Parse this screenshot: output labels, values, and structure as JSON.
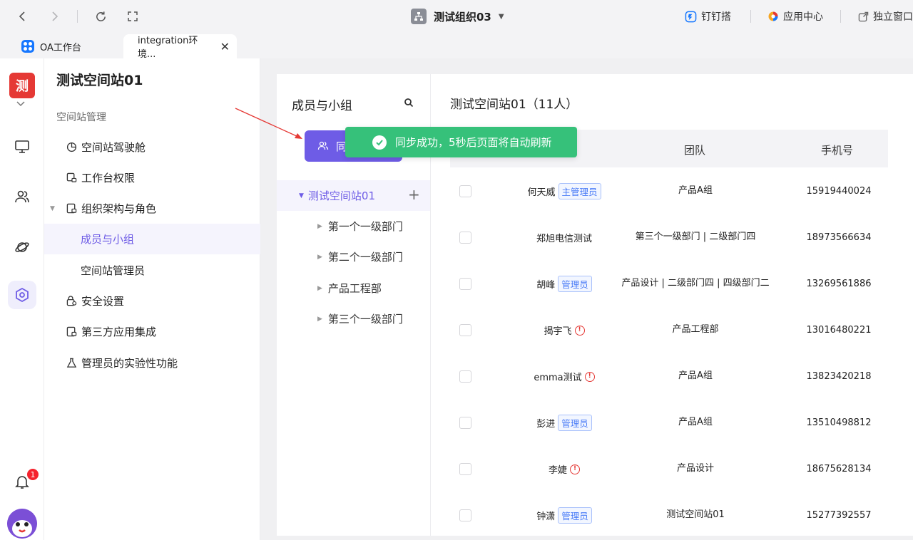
{
  "topbar": {
    "org_title": "测试组织03",
    "links": [
      "钉钉搭",
      "应用中心",
      "独立窗口"
    ]
  },
  "tabs": [
    {
      "label": "OA工作台"
    },
    {
      "label": "integration环境..."
    }
  ],
  "rail": {
    "logo_char": "测",
    "notification_count": "1"
  },
  "sidemenu": {
    "space_title": "测试空间站01",
    "section": "空间站管理",
    "items": [
      {
        "label": "空间站驾驶舱"
      },
      {
        "label": "工作台权限"
      },
      {
        "label": "组织架构与角色"
      },
      {
        "label": "成员与小组"
      },
      {
        "label": "空间站管理员"
      },
      {
        "label": "安全设置"
      },
      {
        "label": "第三方应用集成"
      },
      {
        "label": "管理员的实验性功能"
      }
    ]
  },
  "groups": {
    "title": "成员与小组",
    "sync_label": "同",
    "root": "测试空间站01",
    "nodes": [
      "第一个一级部门",
      "第二个一级部门",
      "产品工程部",
      "第三个一级部门"
    ]
  },
  "members": {
    "title": "测试空间站01（11人）",
    "headers": {
      "team": "团队",
      "phone": "手机号"
    },
    "rows": [
      {
        "name": "何天威",
        "tag": "主管理员",
        "warn": false,
        "team": "产品A组",
        "phone": "15919440024"
      },
      {
        "name": "郑旭电信测试",
        "tag": "",
        "warn": false,
        "team": "第三个一级部门 | 二级部门四",
        "phone": "18973566634"
      },
      {
        "name": "胡峰",
        "tag": "管理员",
        "warn": false,
        "team": "产品设计 | 二级部门四 | 四级部门二",
        "phone": "13269561886"
      },
      {
        "name": "揭宇飞",
        "tag": "",
        "warn": true,
        "team": "产品工程部",
        "phone": "13016480221"
      },
      {
        "name": "emma测试",
        "tag": "",
        "warn": true,
        "team": "产品A组",
        "phone": "13823420218"
      },
      {
        "name": "彭进",
        "tag": "管理员",
        "warn": false,
        "team": "产品A组",
        "phone": "13510498812"
      },
      {
        "name": "李婕",
        "tag": "",
        "warn": true,
        "team": "产品设计",
        "phone": "18675628134"
      },
      {
        "name": "钟潇",
        "tag": "管理员",
        "warn": false,
        "team": "测试空间站01",
        "phone": "15277392557"
      }
    ]
  },
  "toast": {
    "message": "同步成功，5秒后页面将自动刷新"
  },
  "colors": {
    "accent": "#6e5ce6",
    "toast": "#36c17a",
    "badge": "#f5222d"
  }
}
